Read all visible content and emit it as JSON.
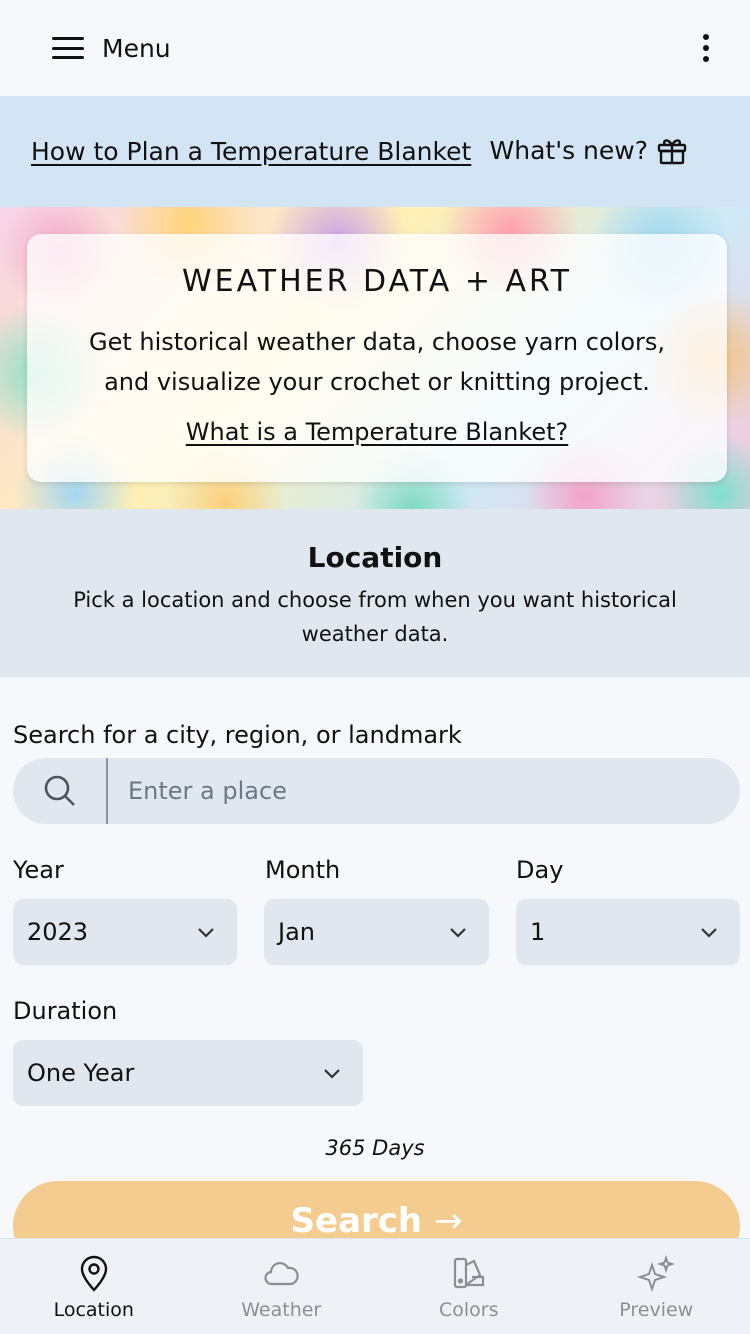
{
  "topbar": {
    "menu_label": "Menu"
  },
  "strip": {
    "plan_link": "How to Plan a Temperature Blanket",
    "whats_new": "What's new?"
  },
  "hero": {
    "title": "WEATHER DATA + ART",
    "description": "Get historical weather data, choose yarn colors, and visualize your crochet or knitting project.",
    "link": "What is a Temperature Blanket?"
  },
  "location": {
    "title": "Location",
    "subtitle": "Pick a location and choose from when you want historical weather data."
  },
  "form": {
    "search_label": "Search for a city, region, or landmark",
    "search_placeholder": "Enter a place",
    "year_label": "Year",
    "year_value": "2023",
    "month_label": "Month",
    "month_value": "Jan",
    "day_label": "Day",
    "day_value": "1",
    "duration_label": "Duration",
    "duration_value": "One Year",
    "days_text": "365 Days",
    "search_button": "Search"
  },
  "bottom_nav": {
    "items": [
      {
        "label": "Location",
        "icon": "map-pin-icon",
        "active": true
      },
      {
        "label": "Weather",
        "icon": "cloud-icon",
        "active": false
      },
      {
        "label": "Colors",
        "icon": "palette-icon",
        "active": false
      },
      {
        "label": "Preview",
        "icon": "sparkles-icon",
        "active": false
      }
    ]
  },
  "colors": {
    "search_button_bg": "#f5cc90",
    "strip_bg": "#d3e4f5",
    "field_bg": "#e1e7ef"
  }
}
